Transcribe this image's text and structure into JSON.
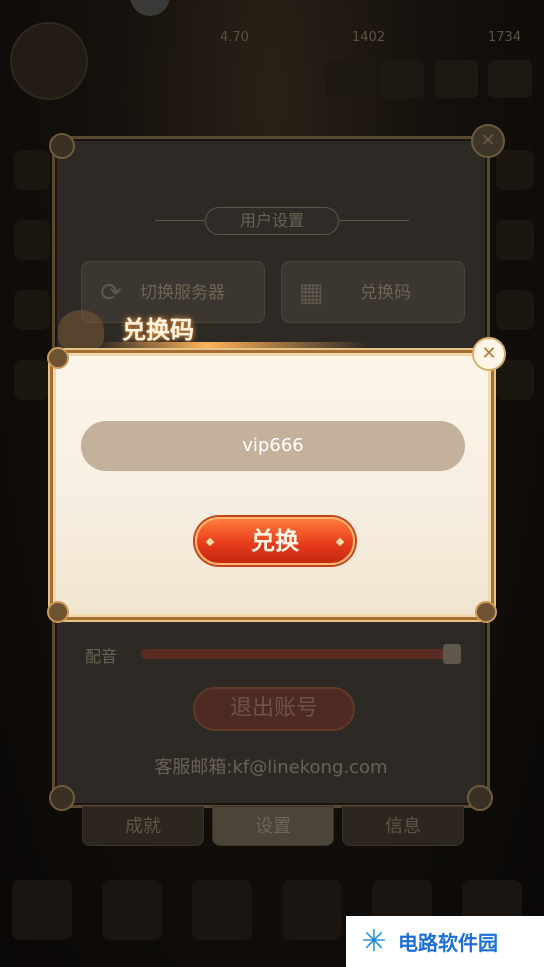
{
  "topbar": {
    "resources": [
      "4.70",
      "1402",
      "1734"
    ]
  },
  "settings": {
    "title": "用户设置",
    "switch_server_label": "切换服务器",
    "redeem_code_label": "兑换码",
    "voice_label": "配音",
    "voice_level": 0.98,
    "logout_label": "退出账号",
    "email_text": "客服邮箱:kf@linekong.com",
    "tabs": [
      "成就",
      "设置",
      "信息"
    ],
    "active_tab": "设置"
  },
  "redeem_dialog": {
    "title": "兑换码",
    "code_value": "vip666",
    "redeem_button_label": "兑换"
  },
  "watermark": {
    "text": "电路软件园"
  },
  "colors": {
    "dialog_border": "#a56f32",
    "button_red": "#e4391a",
    "input_bg": "#c4b19b"
  }
}
